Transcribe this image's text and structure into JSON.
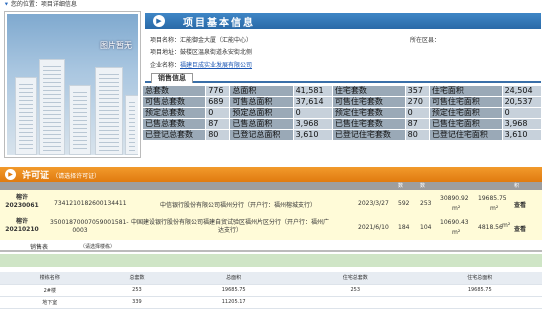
{
  "breadcrumb": {
    "text": "您的位置：项目详细信息"
  },
  "photo": {
    "caption": "图片暂无"
  },
  "section_project": {
    "title": "项目基本信息"
  },
  "project": {
    "name_label": "项目名称：",
    "name_value": "汇能御金大厦（汇能中心）",
    "district_label": "所在区县：",
    "district_value": "",
    "address_label": "项目地址：",
    "address_value": "鼓楼区温泉街道永安街北侧",
    "company_label": "企业名称：",
    "company_value": "福建巨成实业发展有限公司"
  },
  "stats_tab": {
    "label": "销售信息"
  },
  "stats": [
    [
      "总套数",
      "776",
      "总面积",
      "41,581",
      "住宅套数",
      "357",
      "住宅面积",
      "24,504"
    ],
    [
      "可售总套数",
      "689",
      "可售总面积",
      "37,614",
      "可售住宅套数",
      "270",
      "可售住宅面积",
      "20,537"
    ],
    [
      "预定总套数",
      "0",
      "预定总面积",
      "0",
      "预定住宅套数",
      "0",
      "预定住宅面积",
      "0"
    ],
    [
      "已售总套数",
      "87",
      "已售总面积",
      "3,968",
      "已售住宅套数",
      "87",
      "已售住宅面积",
      "3,968"
    ],
    [
      "已登记总套数",
      "80",
      "已登记总面积",
      "3,610",
      "已登记住宅套数",
      "80",
      "已登记住宅面积",
      "3,610"
    ]
  ],
  "section_permit": {
    "title": "许可证",
    "hint": "（请选择许可证）"
  },
  "permit_header": {
    "col_count1": "数",
    "col_count2": "数",
    "col_area": "积"
  },
  "permits": [
    {
      "prefix": "榕许",
      "number": "20230061",
      "code": "7341210182600134411",
      "bank": "中信银行股份有限公司福州分行（开户行：福州榕城支行）",
      "date": "2023/3/27",
      "total_sets": "592",
      "res_sets": "253",
      "total_area": "30890.92",
      "total_area_unit": "m²",
      "res_area": "19685.75",
      "res_area_unit": "m²",
      "action": "查看"
    },
    {
      "prefix": "榕许",
      "number": "20210210",
      "code": "35001870007059001581-0003",
      "bank": "中国建设银行股份有限公司福建自贸试验区福州片区分行（开户行：福州广达支行）",
      "date": "2021/6/10",
      "total_sets": "184",
      "res_sets": "104",
      "total_area": "10690.43",
      "total_area_unit": "m²",
      "res_area": "4818.56",
      "res_area_unit": "m²",
      "action": "查看"
    }
  ],
  "sales": {
    "tab_label": "销售表",
    "hint": "（请选择楼栋）"
  },
  "building_table": {
    "headers": [
      "楼栋名称",
      "总套数",
      "总面积",
      "住宅总套数",
      "住宅总面积"
    ],
    "rows": [
      [
        "2#楼",
        "253",
        "19685.75",
        "253",
        "19685.75"
      ],
      [
        "地下室",
        "339",
        "11205.17",
        "",
        ""
      ]
    ]
  }
}
